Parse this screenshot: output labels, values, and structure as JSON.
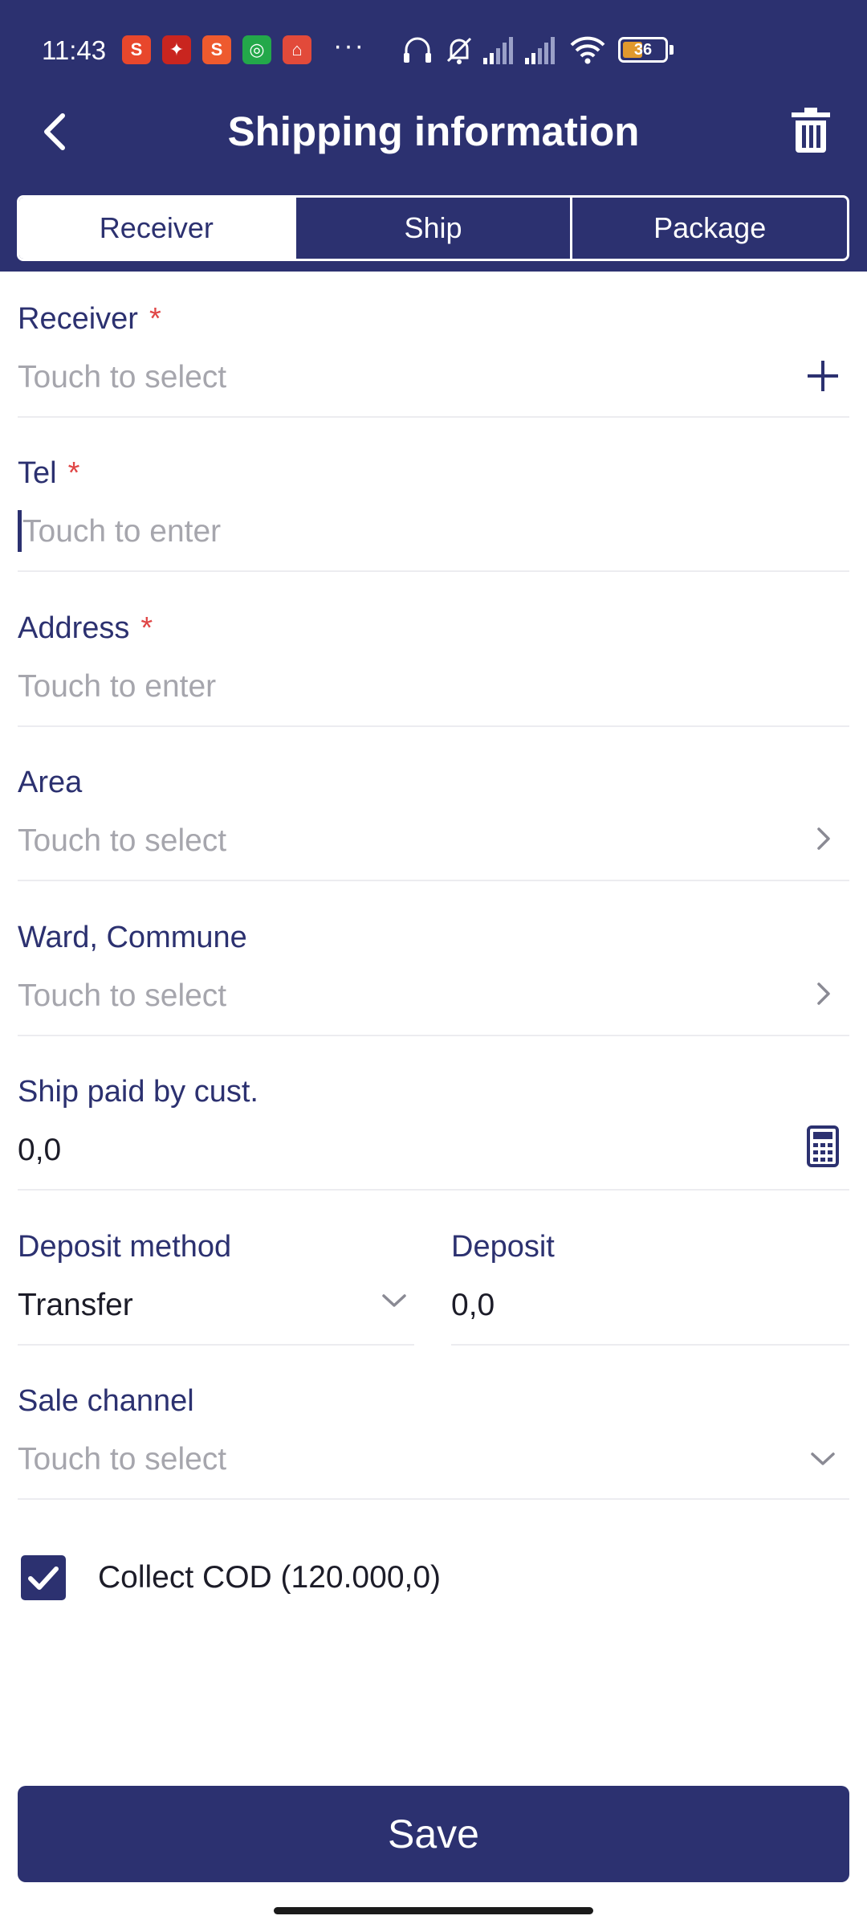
{
  "status_bar": {
    "time": "11:43",
    "battery": "36",
    "more": "···",
    "icons": [
      "shopee-icon",
      "game-icon",
      "shopee-bag-icon",
      "green-app-icon",
      "store-icon",
      "headset-icon",
      "bell-off-icon",
      "signal-1-icon",
      "signal-2-icon",
      "wifi-icon",
      "battery-icon"
    ]
  },
  "header": {
    "title": "Shipping information"
  },
  "tabs": [
    {
      "label": "Receiver",
      "active": true
    },
    {
      "label": "Ship",
      "active": false
    },
    {
      "label": "Package",
      "active": false
    }
  ],
  "form": {
    "receiver": {
      "label": "Receiver",
      "required_mark": "*",
      "placeholder": "Touch to select"
    },
    "tel": {
      "label": "Tel",
      "required_mark": "*",
      "placeholder": "Touch to enter"
    },
    "address": {
      "label": "Address",
      "required_mark": "*",
      "placeholder": "Touch to enter"
    },
    "area": {
      "label": "Area",
      "placeholder": "Touch to select"
    },
    "ward": {
      "label": "Ward, Commune",
      "placeholder": "Touch to select"
    },
    "ship_paid": {
      "label": "Ship paid by cust.",
      "value": "0,0"
    },
    "deposit_method": {
      "label": "Deposit method",
      "value": "Transfer"
    },
    "deposit": {
      "label": "Deposit",
      "value": "0,0"
    },
    "sale_channel": {
      "label": "Sale channel",
      "placeholder": "Touch to select"
    },
    "collect_cod": {
      "label": "Collect COD (120.000,0)",
      "checked": true
    }
  },
  "footer": {
    "save_label": "Save"
  },
  "colors": {
    "primary": "#2c3170",
    "required": "#e04646",
    "placeholder": "#a6a6ad",
    "divider": "#ececf0"
  }
}
